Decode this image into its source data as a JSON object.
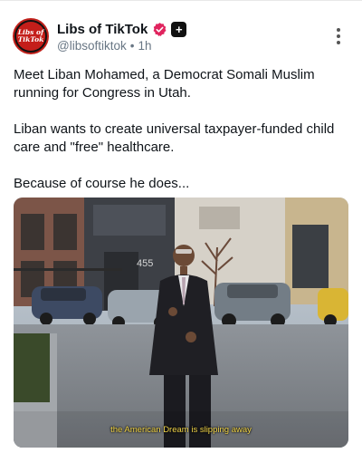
{
  "author": {
    "display_name": "Libs of TikTok",
    "handle": "@libsoftiktok",
    "time": "1h",
    "avatar_text_line1": "Libs of",
    "avatar_text_line2": "TikTok",
    "verified_color": "#e0245e"
  },
  "menu": {
    "icon": "more-vertical-icon"
  },
  "post": {
    "paragraphs": [
      "Meet Liban Mohamed, a Democrat Somali Muslim running for Congress in Utah.",
      "Liban wants to create universal taxpayer-funded child care and \"free\" healthcare.",
      "Because of course he does..."
    ]
  },
  "media": {
    "building_number": "455",
    "caption": "the American Dream is slipping away"
  }
}
